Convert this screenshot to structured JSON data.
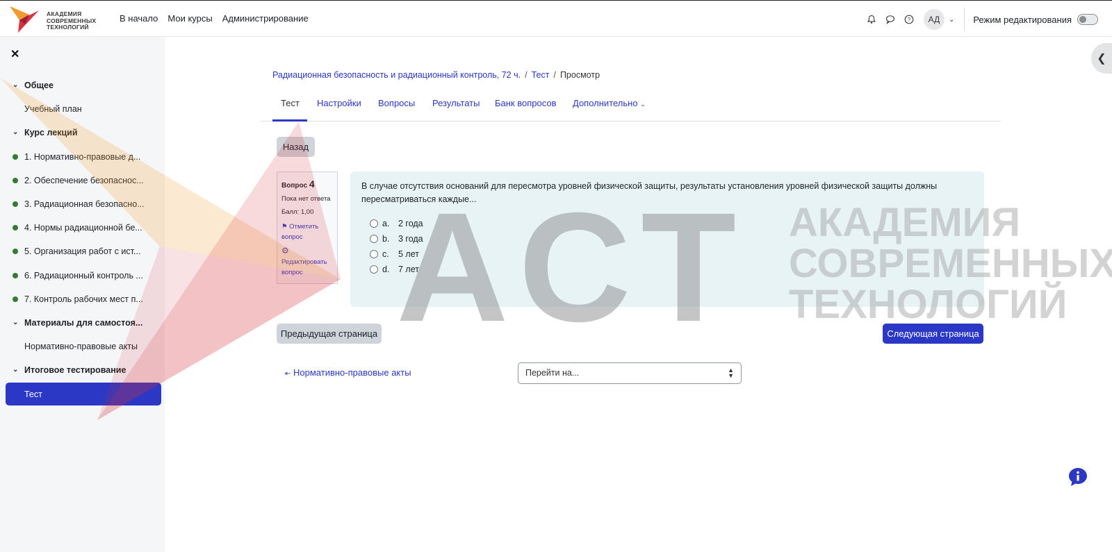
{
  "header": {
    "logo_lines": [
      "АКАДЕМИЯ",
      "СОВРЕМЕННЫХ",
      "ТЕХНОЛОГИЙ"
    ],
    "nav": [
      "В начало",
      "Мои курсы",
      "Администрирование"
    ],
    "avatar_initials": "АД",
    "edit_mode_label": "Режим редактирования"
  },
  "sidebar": {
    "items": [
      {
        "label": "Общее",
        "kind": "section"
      },
      {
        "label": "Учебный план",
        "kind": "plain"
      },
      {
        "label": "Курс лекций",
        "kind": "section"
      },
      {
        "label": "1. Нормативно-правовые д...",
        "kind": "done"
      },
      {
        "label": "2. Обеспечение безопаснос...",
        "kind": "done"
      },
      {
        "label": "3. Радиационная безопасно...",
        "kind": "done"
      },
      {
        "label": "4. Нормы радиационной бе...",
        "kind": "done"
      },
      {
        "label": "5. Организация работ с ист...",
        "kind": "done"
      },
      {
        "label": "6. Радиационный контроль ...",
        "kind": "done"
      },
      {
        "label": "7. Контроль рабочих мест п...",
        "kind": "done"
      },
      {
        "label": "Материалы для самостоя...",
        "kind": "section"
      },
      {
        "label": "Нормативно-правовые акты",
        "kind": "plain"
      },
      {
        "label": "Итоговое тестирование",
        "kind": "section"
      },
      {
        "label": "Тест",
        "kind": "active"
      }
    ]
  },
  "breadcrumb": {
    "course": "Радиационная безопасность и радиационный контроль, 72 ч.",
    "quiz": "Тест",
    "current": "Просмотр"
  },
  "tabs": [
    "Тест",
    "Настройки",
    "Вопросы",
    "Результаты",
    "Банк вопросов",
    "Дополнительно"
  ],
  "buttons": {
    "back": "Назад",
    "prev_page": "Предыдущая страница",
    "next_page": "Следующая страница"
  },
  "question_info": {
    "label": "Вопрос",
    "number": "4",
    "state": "Пока нет ответа",
    "grade": "Балл: 1,00",
    "flag": "Отметить вопрос",
    "edit": "Редактировать вопрос"
  },
  "question": {
    "text": "В случае отсутствия оснований для пересмотра уровней физической защиты, результаты установления уровней физической защиты должны пересматриваться каждые...",
    "answers": [
      {
        "letter": "a.",
        "text": "2 года"
      },
      {
        "letter": "b.",
        "text": "3 года"
      },
      {
        "letter": "c.",
        "text": "5 лет"
      },
      {
        "letter": "d.",
        "text": "7 лет"
      }
    ]
  },
  "navigation": {
    "prev_activity": "Нормативно-правовые акты",
    "jump_placeholder": "Перейти на..."
  },
  "watermark": {
    "letters": "АСТ",
    "lines": [
      "АКАДЕМИЯ",
      "СОВРЕМЕННЫХ",
      "ТЕХНОЛОГИЙ"
    ]
  },
  "colors": {
    "accent": "#2b37c5",
    "complete": "#357a32",
    "question_bg": "#e7f3f5"
  }
}
